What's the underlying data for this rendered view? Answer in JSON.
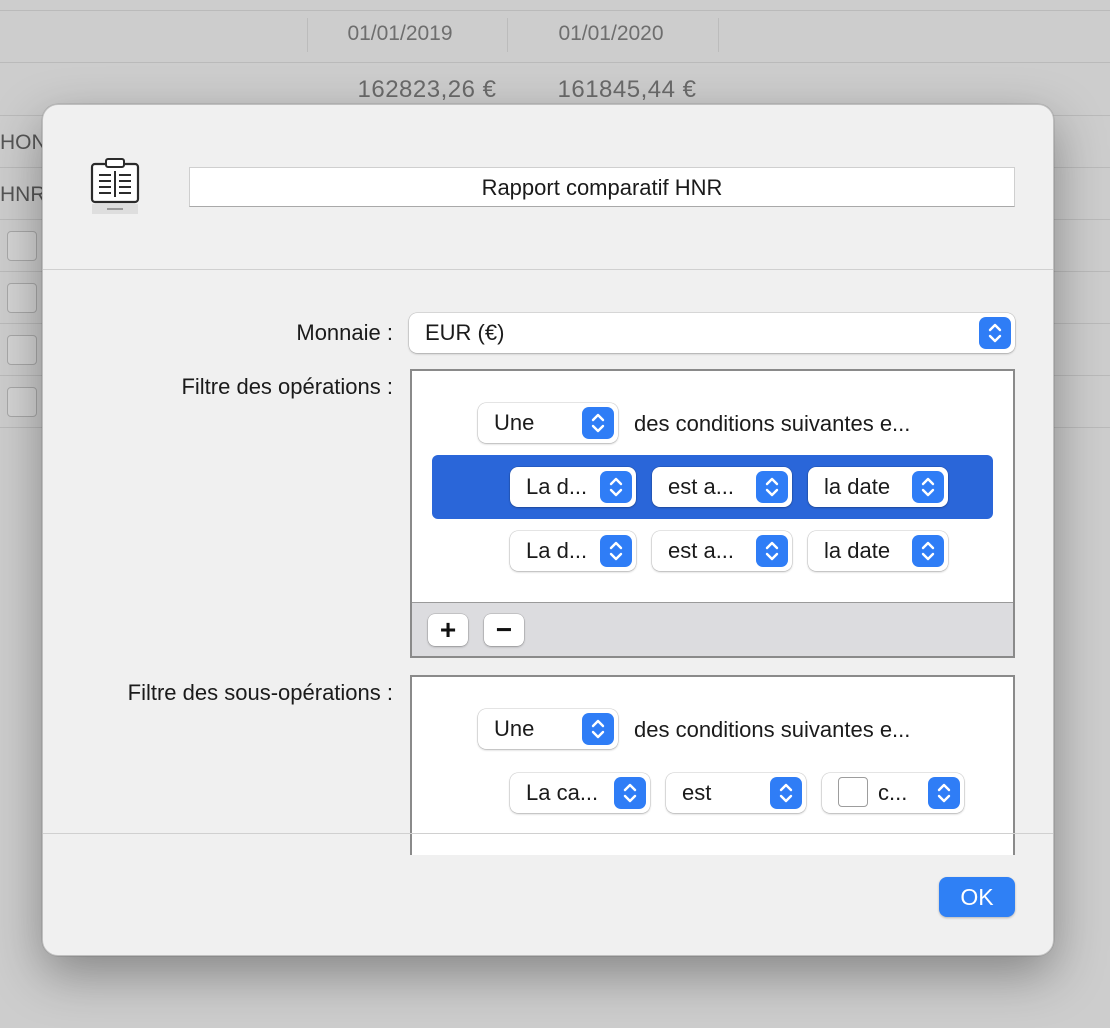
{
  "background": {
    "dates": [
      "01/01/2019",
      "01/01/2020"
    ],
    "amounts": [
      "162823,26 €",
      "161845,44 €"
    ],
    "row_labels": [
      "HON",
      "HNR"
    ]
  },
  "dialog": {
    "report_name": "Rapport comparatif HNR",
    "currency": {
      "label": "Monnaie :",
      "value": "EUR (€)"
    },
    "operations_filter": {
      "label": "Filtre des opérations :",
      "match_select": "Une",
      "match_text": "des conditions suivantes e...",
      "rules": [
        {
          "field": "La d...",
          "operator": "est a...",
          "value": "la date",
          "selected": true
        },
        {
          "field": "La d...",
          "operator": "est a...",
          "value": "la date",
          "selected": false
        }
      ],
      "add_label": "+",
      "remove_label": "−"
    },
    "suboperations_filter": {
      "label": "Filtre des sous-opérations :",
      "match_select": "Une",
      "match_text": "des conditions suivantes e...",
      "rules": [
        {
          "field": "La ca...",
          "operator": "est",
          "value": "c..."
        }
      ]
    },
    "ok_label": "OK"
  },
  "colors": {
    "accent": "#2f7df6",
    "selection": "#2a66d9",
    "sheet": "#f0f0f0"
  },
  "icons": [
    "report-clipboard-icon",
    "up-down-chevron-icon"
  ]
}
